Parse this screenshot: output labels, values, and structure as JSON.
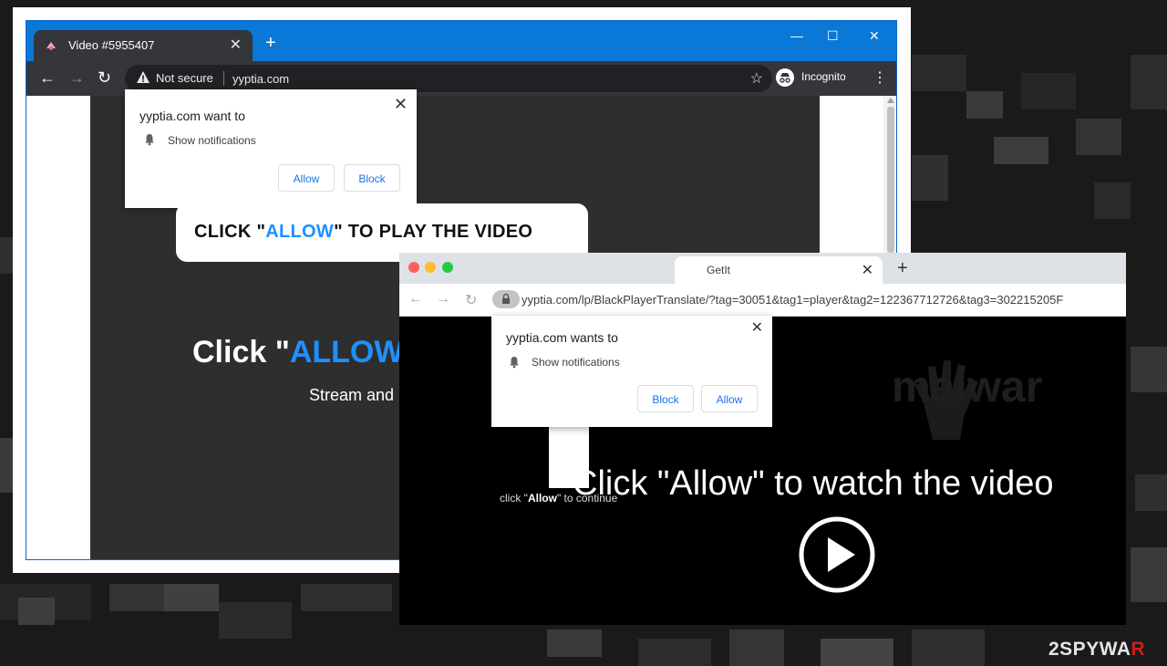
{
  "window1": {
    "tab_title": "Video #5955407",
    "tab_close": "✕",
    "new_tab": "+",
    "controls": {
      "minimize": "—",
      "maximize": "☐",
      "close": "✕"
    },
    "nav": {
      "back": "←",
      "forward": "→",
      "reload": "↻"
    },
    "security_label": "Not secure",
    "url": "yyptia.com",
    "star": "☆",
    "profile_label": "Incognito",
    "menu": "⋮",
    "popup": {
      "title": "yyptia.com want to",
      "permission": "Show notifications",
      "close": "✕",
      "allow": "Allow",
      "block": "Block"
    },
    "bubble": {
      "pre": "CLICK \"",
      "accent": "ALLOW",
      "post": "\" TO PLAY THE VIDEO"
    },
    "headline": {
      "pre": "Click \"",
      "accent": "ALLOW"
    },
    "subtext": "Stream and"
  },
  "window2": {
    "tab_title": "GetIt",
    "tab_close": "✕",
    "new_tab": "+",
    "nav": {
      "back": "←",
      "forward": "→",
      "reload": "↻"
    },
    "url": "yyptia.com/lp/BlackPlayerTranslate/?tag=30051&tag1=player&tag2=122367712726&tag3=302215205F",
    "watermark": "malwar",
    "popup": {
      "title": "yyptia.com wants to",
      "permission": "Show notifications",
      "close": "✕",
      "block": "Block",
      "allow": "Allow"
    },
    "headline": "Click \"Allow\" to watch the video",
    "small": {
      "pre": "click \"",
      "bold": "Allow",
      "post": "\" to continue"
    }
  },
  "logo": {
    "part1": "2SPYWA",
    "part2": "R"
  },
  "colors": {
    "titlebar_blue": "#0a78d7",
    "accent_blue": "#1e90ff",
    "link_blue": "#1a73e8",
    "logo_red": "#d01c1c",
    "mac_red": "#ff5f57",
    "mac_yellow": "#febc2e",
    "mac_green": "#28c840"
  }
}
